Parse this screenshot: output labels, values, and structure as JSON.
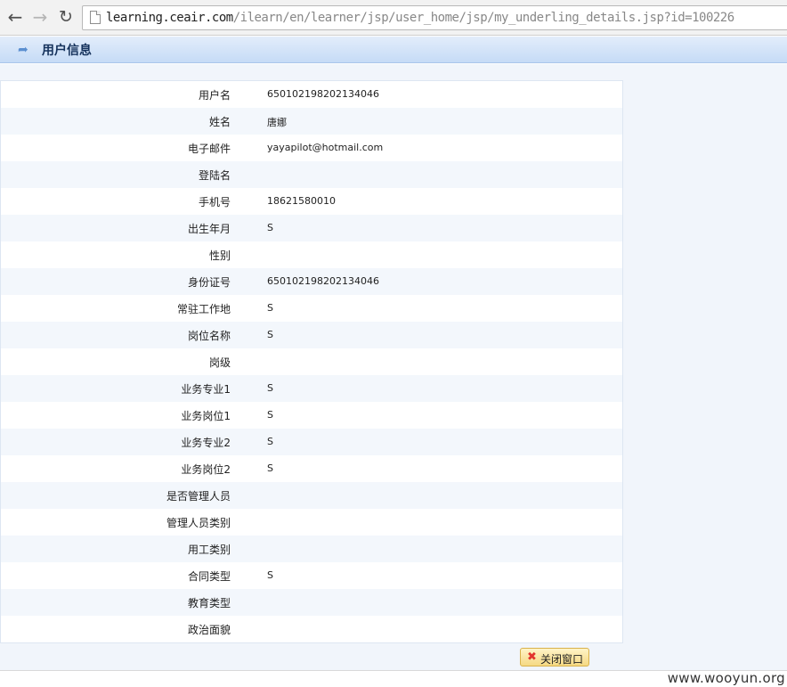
{
  "browser": {
    "url_host": "learning.ceair.com",
    "url_path": "/ilearn/en/learner/jsp/user_home/jsp/my_underling_details.jsp?id=100226"
  },
  "page": {
    "title": "用户信息"
  },
  "fields": [
    {
      "label": "用户名",
      "value": "650102198202134046"
    },
    {
      "label": "姓名",
      "value": "唐娜"
    },
    {
      "label": "电子邮件",
      "value": "yayapilot@hotmail.com"
    },
    {
      "label": "登陆名",
      "value": ""
    },
    {
      "label": "手机号",
      "value": "18621580010"
    },
    {
      "label": "出生年月",
      "value": "S"
    },
    {
      "label": "性别",
      "value": ""
    },
    {
      "label": "身份证号",
      "value": "650102198202134046"
    },
    {
      "label": "常驻工作地",
      "value": "S"
    },
    {
      "label": "岗位名称",
      "value": "S"
    },
    {
      "label": "岗级",
      "value": ""
    },
    {
      "label": "业务专业1",
      "value": "S"
    },
    {
      "label": "业务岗位1",
      "value": "S"
    },
    {
      "label": "业务专业2",
      "value": "S"
    },
    {
      "label": "业务岗位2",
      "value": "S"
    },
    {
      "label": "是否管理人员",
      "value": ""
    },
    {
      "label": "管理人员类别",
      "value": ""
    },
    {
      "label": "用工类别",
      "value": ""
    },
    {
      "label": "合同类型",
      "value": "S"
    },
    {
      "label": "教育类型",
      "value": ""
    },
    {
      "label": "政治面貌",
      "value": ""
    }
  ],
  "close_button": {
    "label": "关闭窗口"
  },
  "watermark": "www.wooyun.org"
}
